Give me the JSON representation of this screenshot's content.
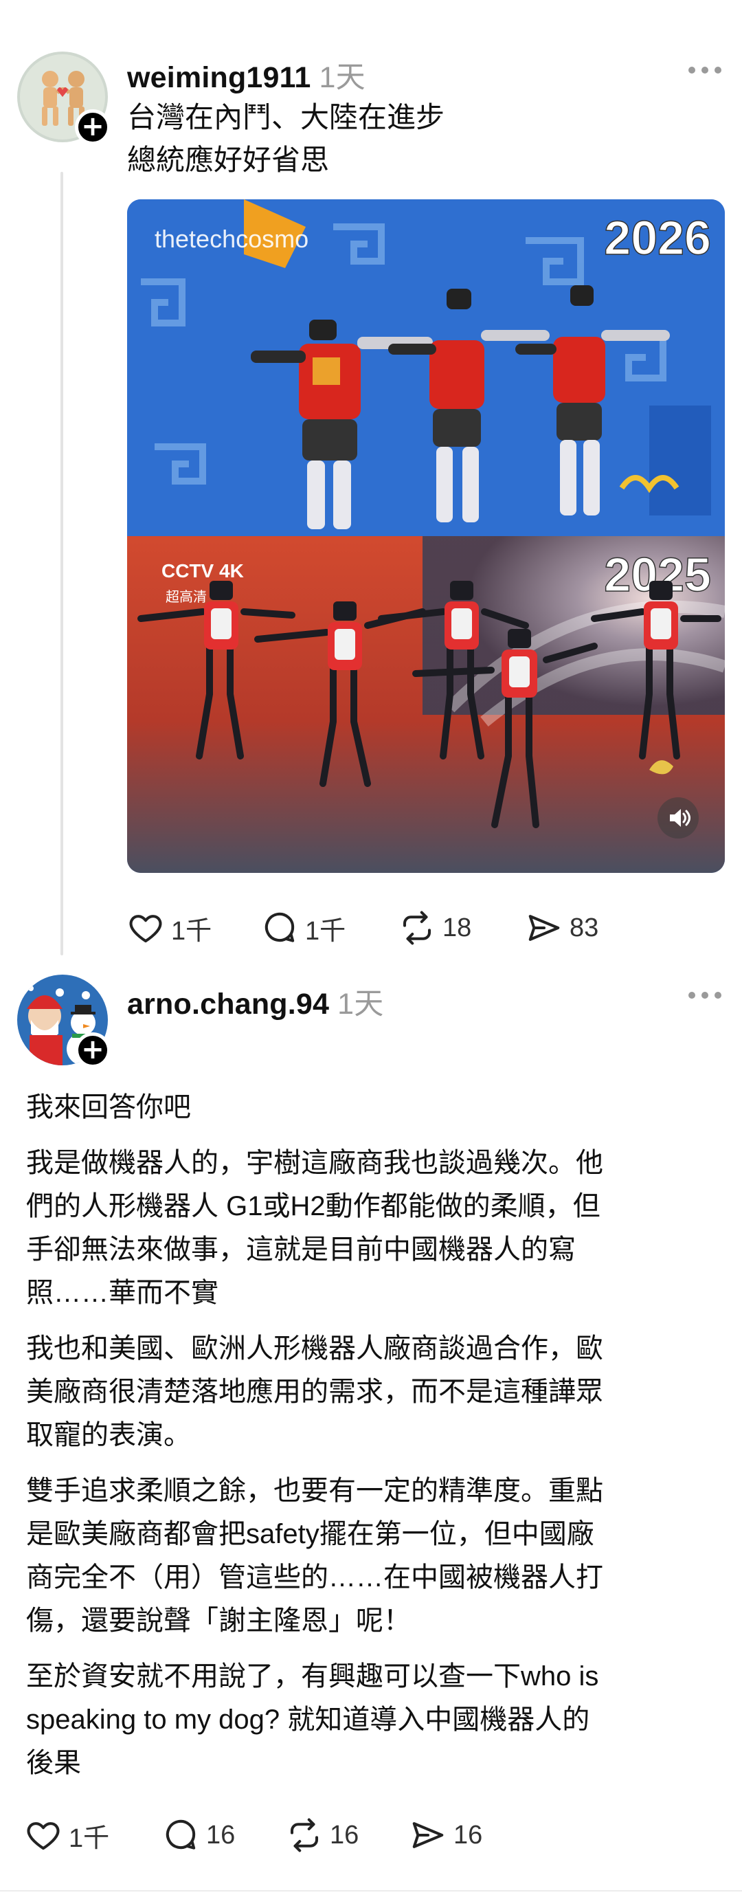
{
  "post1": {
    "username": "weiming1911",
    "time": "1天",
    "lines": [
      "台灣在內鬥、大陸在進步",
      "總統應好好省思"
    ],
    "video": {
      "watermark": "thetechcosmo",
      "top_year": "2026",
      "bottom_year": "2025",
      "channel_logo": "CCTV 4K",
      "channel_sub": "超高清"
    },
    "actions": {
      "likes": "1千",
      "comments": "1千",
      "reposts": "18",
      "shares": "83"
    }
  },
  "post2": {
    "username": "arno.chang.94",
    "time": "1天",
    "paragraphs": [
      [
        "我來回答你吧"
      ],
      [
        "我是做機器人的，宇樹這廠商我也談過幾次。他",
        "們的人形機器人 G1或H2動作都能做的柔順，但",
        "手卻無法來做事，這就是目前中國機器人的寫",
        "照……華而不實"
      ],
      [
        "我也和美國、歐洲人形機器人廠商談過合作，歐",
        "美廠商很清楚落地應用的需求，而不是這種譁眾",
        "取寵的表演。"
      ],
      [
        "雙手追求柔順之餘，也要有一定的精準度。重點",
        "是歐美廠商都會把safety擺在第一位，但中國廠",
        "商完全不（用）管這些的……在中國被機器人打",
        "傷，還要說聲「謝主隆恩」呢！"
      ],
      [
        "至於資安就不用說了，有興趣可以查一下who is",
        "speaking to my dog? 就知道導入中國機器人的",
        "後果"
      ]
    ],
    "actions": {
      "likes": "1千",
      "comments": "16",
      "reposts": "16",
      "shares": "16"
    }
  }
}
